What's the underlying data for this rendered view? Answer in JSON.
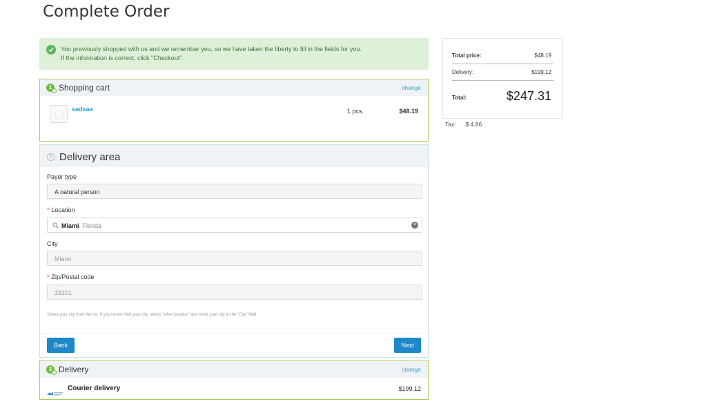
{
  "page": {
    "title": "Complete Order"
  },
  "notice": {
    "line1": "You previously shopped with us and we remember you, so we have taken the liberty to fill in the fields for you.",
    "line2": "If the information is correct, click \"Checkout\"."
  },
  "cart": {
    "title": "Shopping cart",
    "step": "1",
    "change_label": "change",
    "items": [
      {
        "name": "sadsaa",
        "qty": "1 pcs.",
        "price": "$48.19"
      }
    ]
  },
  "delivery_area": {
    "step": "2",
    "title": "Delivery area",
    "payer_type_label": "Payer type",
    "payer_type_value": "A natural person",
    "location_label": "Location",
    "location_city": "Miami",
    "location_region": ", Florida",
    "city_label": "City",
    "city_value": "Miami",
    "zip_label": "Zip/Postal code",
    "zip_value": "33101",
    "hint": "Select your city from the list. If you cannot find your city, select \"other location\" and enter your city in the \"City\" field.",
    "back_label": "Back",
    "next_label": "Next"
  },
  "delivery": {
    "step": "3",
    "title": "Delivery",
    "change_label": "change",
    "service_name": "Courier delivery",
    "service_price": "$199.12"
  },
  "summary": {
    "total_price_label": "Total price:",
    "total_price_value": "$48.19",
    "delivery_label": "Delivery:",
    "delivery_value": "$199.12",
    "total_label": "Total:",
    "total_value": "$247.31",
    "tax_label": "Tax:",
    "tax_value": "$ 4.86"
  },
  "colors": {
    "accent_blue": "#1e88c9",
    "link": "#2aa3c9",
    "success_bg": "#dff0d8",
    "success_text": "#3c763d",
    "step_done": "#6cbf3a"
  },
  "icons": [
    "check-circle-icon",
    "search-icon",
    "clear-icon",
    "courier-logo-icon"
  ]
}
